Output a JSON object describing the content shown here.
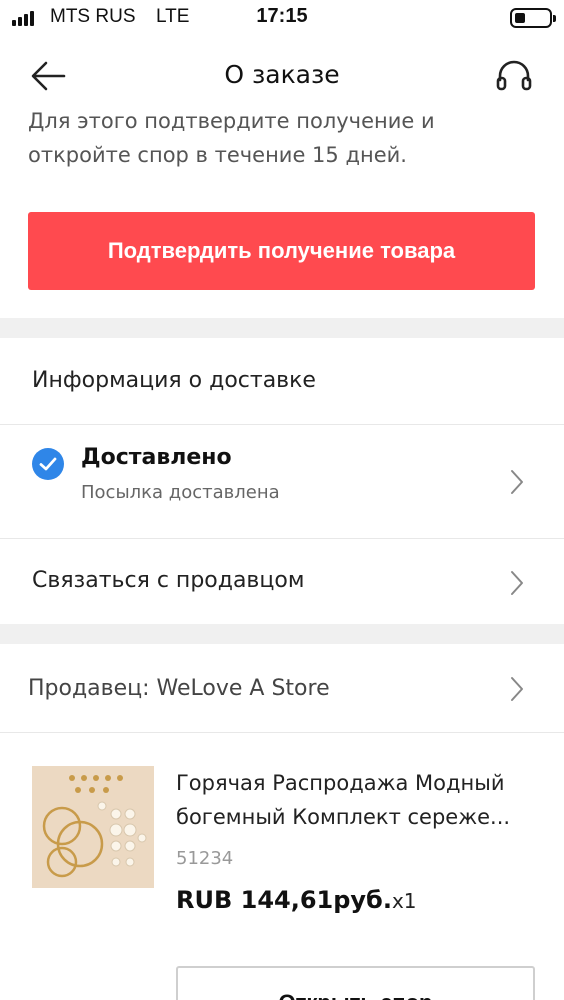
{
  "status_bar": {
    "carrier": "MTS RUS",
    "network": "LTE",
    "time": "17:15"
  },
  "nav": {
    "title": "О заказе",
    "back_icon": "arrow-left-icon",
    "support_icon": "headset-icon"
  },
  "notice": {
    "text": "Для этого подтвердите получение и откройте спор в течение 15 дней."
  },
  "confirm_button": {
    "label": "Подтвердить получение товара",
    "color": "#ff4a4f"
  },
  "delivery_info": {
    "title": "Информация о доставке",
    "status": "Доставлено",
    "status_detail": "Посылка доставлена",
    "status_icon": "check-circle-icon",
    "status_color": "#2f86e8"
  },
  "contact_seller": {
    "label": "Связаться с продавцом"
  },
  "seller": {
    "label": "Продавец: WeLove A Store"
  },
  "product": {
    "title_line1": "Горячая Распродажа Модный",
    "title_line2": "богемный Комплект сереже...",
    "sku": "51234",
    "price": "RUB 144,61руб.",
    "quantity": "x1",
    "image": "earrings-set-image"
  },
  "dispute_button": {
    "label": "Открыть спор"
  }
}
